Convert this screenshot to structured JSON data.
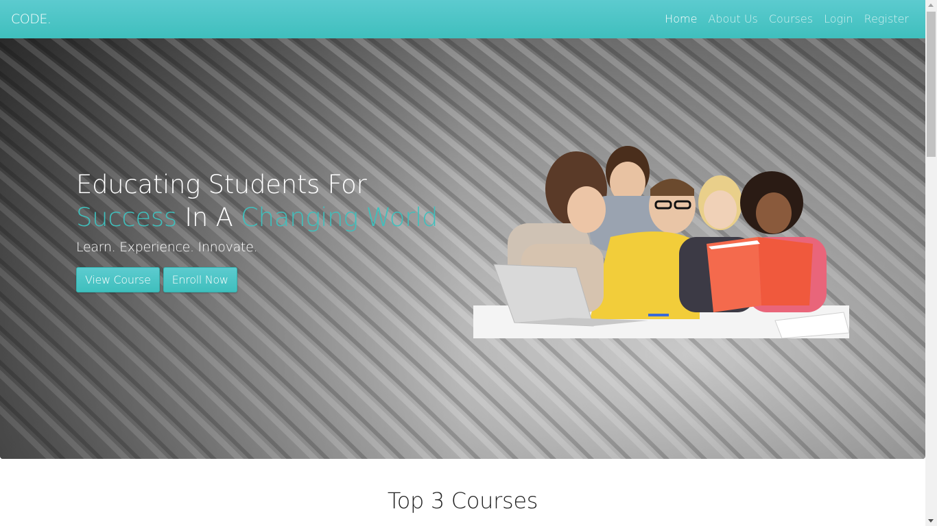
{
  "navbar": {
    "brand": "CODE.",
    "links": [
      {
        "label": "Home",
        "active": true
      },
      {
        "label": "About Us",
        "active": false
      },
      {
        "label": "Courses",
        "active": false
      },
      {
        "label": "Login",
        "active": false
      },
      {
        "label": "Register",
        "active": false
      }
    ]
  },
  "hero": {
    "headline_line1": "Educating Students For",
    "headline_line2": {
      "part1": "Success",
      "part2": " In A ",
      "part3": "Changing World"
    },
    "tagline": "Learn. Experience. Innovate.",
    "buttons": {
      "view_course": "View Course",
      "enroll_now": "Enroll Now"
    },
    "image_icon": "students-reading-photo"
  },
  "section": {
    "title": "Top 3 Courses"
  },
  "colors": {
    "accent": "#3fc0bd",
    "navbar_top": "#5ccbcf",
    "navbar_bottom": "#3fbfbd"
  }
}
